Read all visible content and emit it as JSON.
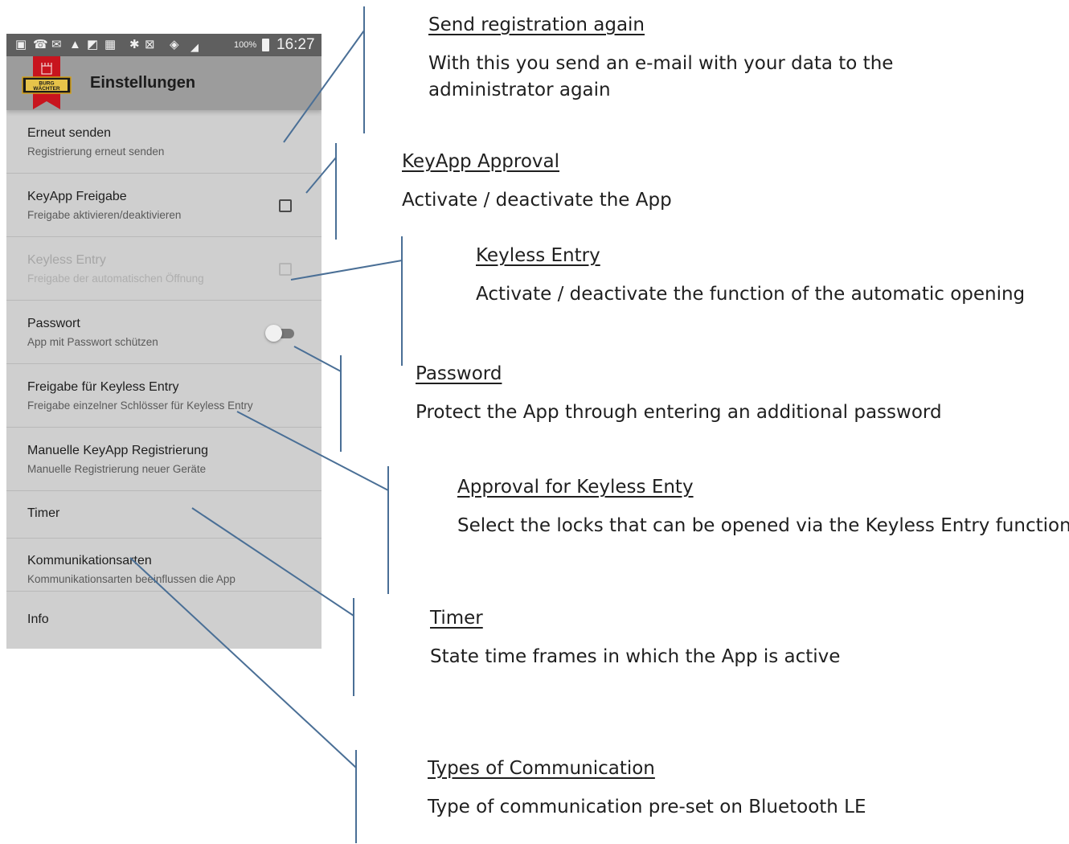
{
  "statusbar": {
    "icons": [
      "gallery-icon",
      "voicemail-icon",
      "mail-icon",
      "warning-icon",
      "screenshot-icon",
      "calendar-check-icon",
      "bluetooth-icon",
      "nfc-icon",
      "wifi-icon",
      "signal-icon"
    ],
    "battery": "100%",
    "time": "16:27"
  },
  "appbar": {
    "logo_text": "BURG WÄCHTER",
    "title": "Einstellungen"
  },
  "settings": [
    {
      "title": "Erneut senden",
      "subtitle": "Registrierung erneut senden"
    },
    {
      "title": "KeyApp Freigabe",
      "subtitle": "Freigabe aktivieren/deaktivieren",
      "checked": false
    },
    {
      "title": "Keyless Entry",
      "subtitle": "Freigabe der automatischen Öffnung",
      "checked": false,
      "enabled": false
    },
    {
      "title": "Passwort",
      "subtitle": "App mit Passwort schützen",
      "toggle_on": false
    },
    {
      "title": "Freigabe für Keyless Entry",
      "subtitle": "Freigabe einzelner Schlösser für Keyless Entry"
    },
    {
      "title": "Manuelle KeyApp Registrierung",
      "subtitle": "Manuelle Registrierung neuer Geräte"
    },
    {
      "title": "Timer"
    },
    {
      "title": "Kommunikationsarten",
      "subtitle": "Kommunikationsarten beeinflussen die App"
    },
    {
      "title": "Info"
    }
  ],
  "callouts": [
    {
      "heading": "Send registration again",
      "description": "With this you send an e-mail with your data to the\nadministrator again"
    },
    {
      "heading": "KeyApp Approval",
      "description": "Activate / deactivate the App"
    },
    {
      "heading": "Keyless Entry",
      "description": "Activate / deactivate the function of the automatic opening"
    },
    {
      "heading": "Password",
      "description": "Protect the App through entering an additional password"
    },
    {
      "heading": "Approval for Keyless Enty",
      "description": "Select the locks that can be opened via the Keyless Entry function"
    },
    {
      "heading": "Timer",
      "description": "State time frames in which the App is active"
    },
    {
      "heading": "Types of Communication",
      "description": "Type of communication pre-set on Bluetooth LE"
    }
  ],
  "colors": {
    "leader_line": "#4a6f96",
    "appbar": "#9c9c9c",
    "list_background": "#cfcfcf",
    "logo_red": "#c8141e"
  }
}
